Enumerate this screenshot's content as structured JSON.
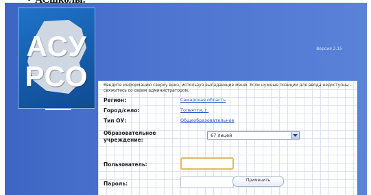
{
  "caption": {
    "bullet": "•",
    "text": "АСшколы."
  },
  "logo": {
    "line1": "АСУ",
    "line2": "РСО"
  },
  "header": {
    "version": "Версия 2.15"
  },
  "login_form": {
    "intro": "Введите информацию сверху вниз, используя выпадающие меню. Если нужные позиции для ввода недоступны - свяжитесь со своим администратором.",
    "region": {
      "label": "Регион:",
      "value": "Самарская область"
    },
    "city": {
      "label": "Город/село:",
      "value": "Тольятти, г."
    },
    "org_type": {
      "label": "Тип ОУ:",
      "value": "Общеобразовательное"
    },
    "institution": {
      "label_line1": "Образовательное",
      "label_line2": "учреждение:",
      "selected": "67 лицей"
    },
    "user": {
      "label": "Пользователь:",
      "value": ""
    },
    "password": {
      "label": "Пароль:",
      "value": ""
    },
    "apply_button": "Применить"
  },
  "colors": {
    "header_blue": "#4d74cf",
    "logo_blue": "#155aa8",
    "link_blue": "#2a54c5",
    "focus_border": "#e0b860"
  },
  "icons": {
    "select_arrow": "chevron-down-icon"
  }
}
